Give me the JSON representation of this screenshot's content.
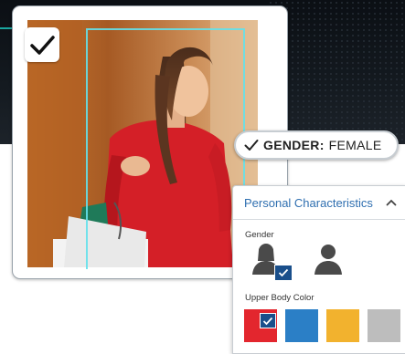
{
  "overlay": {
    "gender_key": "GENDER:",
    "gender_value": "FEMALE"
  },
  "panel": {
    "title": "Personal Characteristics",
    "gender_label": "Gender",
    "upper_body_label": "Upper Body Color",
    "gender_options": [
      {
        "icon": "female-person-icon",
        "selected": true
      },
      {
        "icon": "male-person-icon",
        "selected": false
      }
    ],
    "colors": [
      {
        "name": "red",
        "hex": "#e3262e",
        "selected": true
      },
      {
        "name": "blue",
        "hex": "#2b7fc6",
        "selected": false
      },
      {
        "name": "yellow",
        "hex": "#f2b22e",
        "selected": false
      },
      {
        "name": "gray",
        "hex": "#bdbdbd",
        "selected": false
      }
    ]
  },
  "colors": {
    "accent": "#2f6fb0",
    "check_badge": "#1a4f8b",
    "detection_frame": "#64e1eb"
  }
}
